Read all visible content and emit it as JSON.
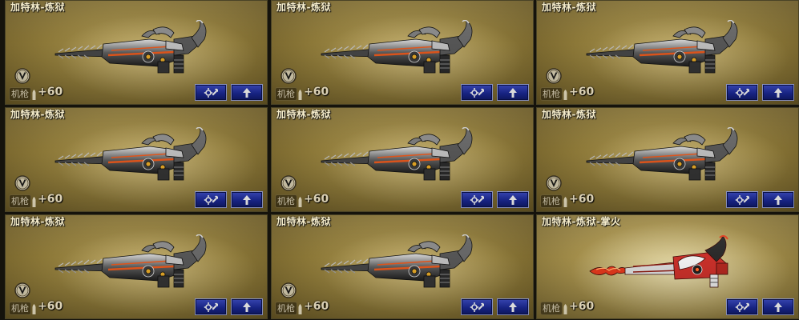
{
  "cards": [
    {
      "title": "加特林-炼狱",
      "type_label": "机枪",
      "ammo_bonus": "+60",
      "variant": "standard",
      "badge_icon": "v-rank-icon"
    },
    {
      "title": "加特林-炼狱",
      "type_label": "机枪",
      "ammo_bonus": "+60",
      "variant": "standard",
      "badge_icon": "v-rank-icon"
    },
    {
      "title": "加特林-炼狱",
      "type_label": "机枪",
      "ammo_bonus": "+60",
      "variant": "standard",
      "badge_icon": "v-rank-icon"
    },
    {
      "title": "加特林-炼狱",
      "type_label": "机枪",
      "ammo_bonus": "+60",
      "variant": "standard",
      "badge_icon": "v-rank-icon"
    },
    {
      "title": "加特林-炼狱",
      "type_label": "机枪",
      "ammo_bonus": "+60",
      "variant": "standard",
      "badge_icon": "v-rank-icon"
    },
    {
      "title": "加特林-炼狱",
      "type_label": "机枪",
      "ammo_bonus": "+60",
      "variant": "standard",
      "badge_icon": "v-rank-icon"
    },
    {
      "title": "加特林-炼狱",
      "type_label": "机枪",
      "ammo_bonus": "+60",
      "variant": "standard",
      "badge_icon": "v-rank-icon"
    },
    {
      "title": "加特林-炼狱",
      "type_label": "机枪",
      "ammo_bonus": "+60",
      "variant": "standard",
      "badge_icon": "v-rank-icon"
    },
    {
      "title": "加特林-炼狱-掌火",
      "type_label": "机枪",
      "ammo_bonus": "+60",
      "variant": "fire",
      "badge_icon": ""
    }
  ],
  "buttons": {
    "config_icon": "gear-wrench-icon",
    "upgrade_icon": "arrow-up-icon"
  },
  "colors": {
    "button_blue": "#1c2a9a",
    "title_text": "#f5ecc8",
    "card_gold": "#8c7838"
  }
}
